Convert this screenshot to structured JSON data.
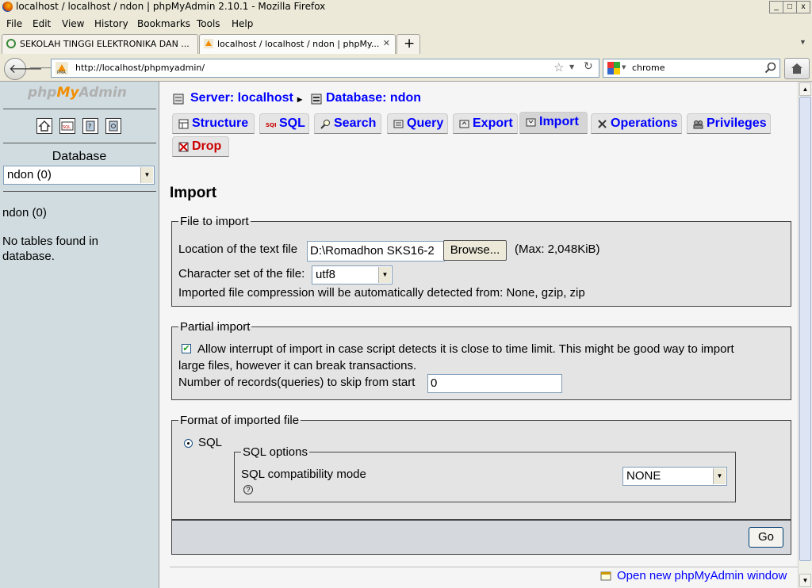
{
  "window": {
    "title": "localhost / localhost / ndon | phpMyAdmin 2.10.1 - Mozilla Firefox",
    "buttons": [
      "_",
      "□",
      "x"
    ]
  },
  "menu": [
    "File",
    "Edit",
    "View",
    "History",
    "Bookmarks",
    "Tools",
    "Help"
  ],
  "tabs": [
    {
      "label": "SEKOLAH TINGGI ELEKTRONIKA DAN ...",
      "active": false
    },
    {
      "label": "localhost / localhost / ndon | phpMy...",
      "active": true
    }
  ],
  "new_tab": "+",
  "url": "http://localhost/phpmyadmin/",
  "search": {
    "value": "chrome"
  },
  "sidebar": {
    "logo_php": "php",
    "logo_my": "My",
    "logo_admin": "Admin",
    "database_label": "Database",
    "database_select": "ndon (0)",
    "db_name": "ndon (0)",
    "no_tables": "No tables found in database."
  },
  "breadcrumb": {
    "server": "Server: localhost",
    "sep": "▸",
    "database": "Database: ndon"
  },
  "nav_tabs": [
    {
      "label": "Structure",
      "icon": "structure-icon"
    },
    {
      "label": "SQL",
      "icon": "sql-icon"
    },
    {
      "label": "Search",
      "icon": "search-icon"
    },
    {
      "label": "Query",
      "icon": "query-icon"
    },
    {
      "label": "Export",
      "icon": "export-icon"
    },
    {
      "label": "Import",
      "icon": "import-icon"
    },
    {
      "label": "Operations",
      "icon": "operations-icon"
    },
    {
      "label": "Privileges",
      "icon": "privileges-icon"
    },
    {
      "label": "Drop",
      "icon": "drop-icon"
    }
  ],
  "page_title": "Import",
  "file_to_import": {
    "legend": "File to import",
    "location_label": "Location of the text file",
    "location_value": "D:\\Romadhon SKS16-2",
    "browse_label": "Browse...",
    "max_label": "(Max: 2,048KiB)",
    "charset_label": "Character set of the file:",
    "charset_value": "utf8",
    "compression_note": "Imported file compression will be automatically detected from: None, gzip, zip"
  },
  "partial_import": {
    "legend": "Partial import",
    "allow_interrupt_checked": true,
    "allow_interrupt_label": "Allow interrupt of import in case script detects it is close to time limit. This might be good way to import",
    "allow_interrupt_label_2": "large files, however it can break transactions.",
    "skip_label": "Number of records(queries) to skip from start",
    "skip_value": "0"
  },
  "format": {
    "legend": "Format of imported file",
    "sql_radio_label": "SQL",
    "sql_options_legend": "SQL options",
    "compat_label": "SQL compatibility mode",
    "compat_value": "NONE",
    "help_icon": "?"
  },
  "go_label": "Go",
  "footer_link": "Open new phpMyAdmin window",
  "colors": {
    "link": "#0000ff",
    "sidebar_bg": "#d0dce0",
    "drop": "#cc0000",
    "logo_orange": "#f28d00"
  }
}
